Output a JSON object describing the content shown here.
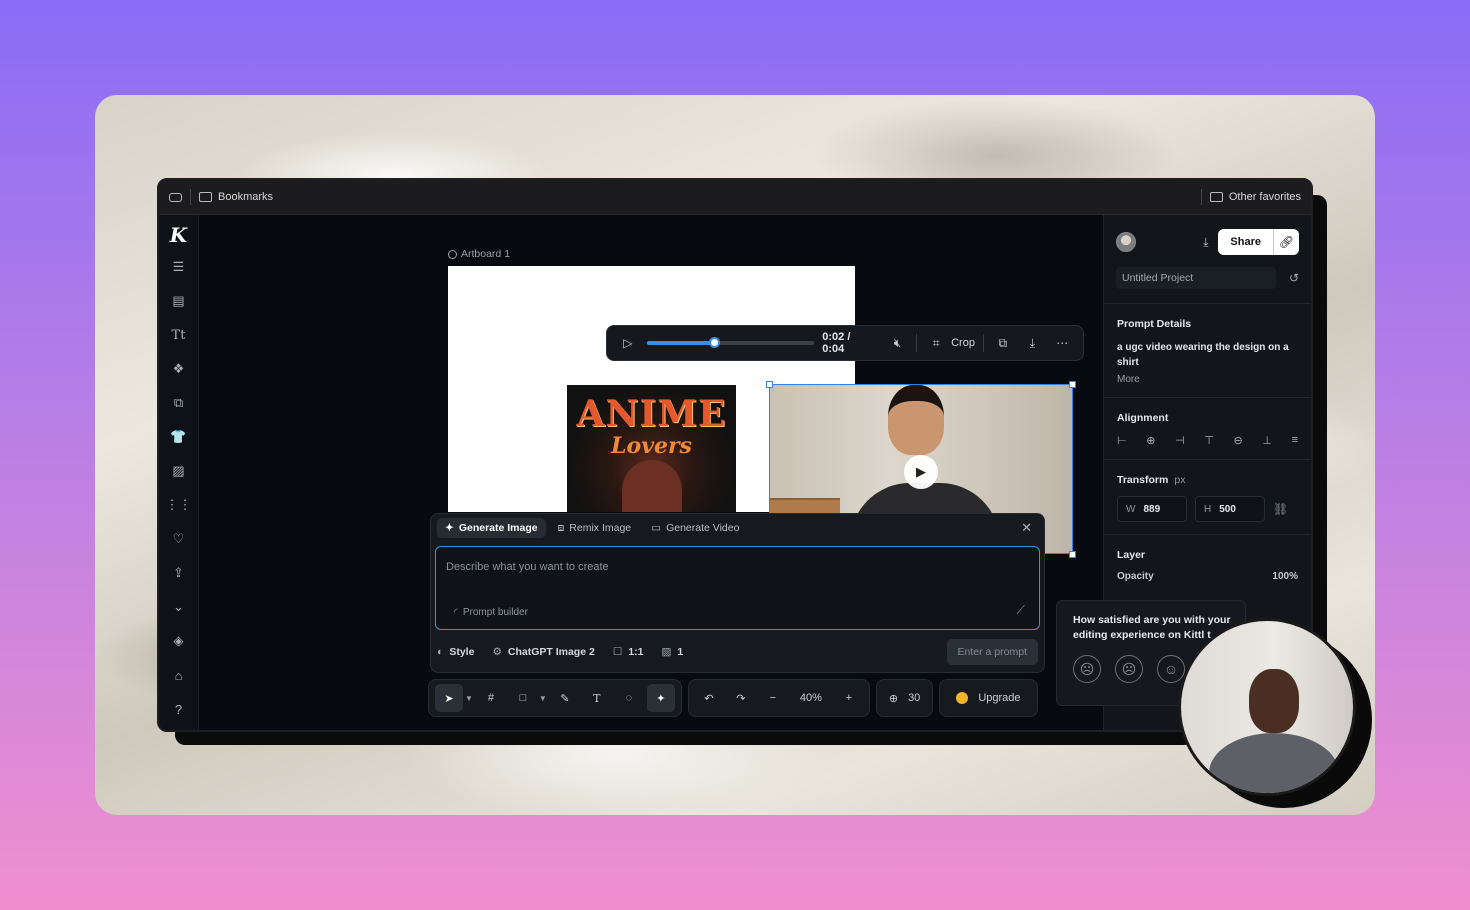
{
  "bookmarks_bar": {
    "bookmarks_label": "Bookmarks",
    "other_favorites_label": "Other favorites"
  },
  "app": {
    "logo": "K",
    "artboard_label": "Artboard 1",
    "left_rail_icons": [
      "menu-icon",
      "layout-icon",
      "text-icon",
      "elements-icon",
      "image-edit-icon",
      "shirt-icon",
      "image-icon",
      "grid-icon",
      "heart-icon",
      "upload-icon",
      "chevron-down-icon",
      "layers-icon",
      "graduation-cap-icon",
      "help-icon"
    ]
  },
  "media_toolbar": {
    "timecode": "0:02 / 0:04",
    "progress": 0.4,
    "crop_label": "Crop"
  },
  "shirt_design": {
    "title": "ANIME",
    "subtitle": "Lovers"
  },
  "generate_panel": {
    "tabs": [
      {
        "label": "Generate Image",
        "active": true
      },
      {
        "label": "Remix Image",
        "active": false
      },
      {
        "label": "Generate Video",
        "active": false
      }
    ],
    "placeholder": "Describe what you want to create",
    "prompt_builder_label": "Prompt builder",
    "style_label": "Style",
    "model_label": "ChatGPT Image 2",
    "ratio_label": "1:1",
    "count_label": "1",
    "enter_button_label": "Enter a prompt"
  },
  "bottom_toolbar": {
    "zoom_minus": "−",
    "zoom": "40%",
    "zoom_plus": "+",
    "credits": "30",
    "upgrade_label": "Upgrade"
  },
  "right_panel": {
    "share_label": "Share",
    "project_name": "Untitled Project",
    "prompt_details_title": "Prompt Details",
    "prompt_text": "a ugc video wearing the design on a shirt",
    "more_label": "More",
    "alignment_title": "Alignment",
    "transform_title": "Transform",
    "transform_unit": "px",
    "width_label": "W",
    "width_value": "889",
    "height_label": "H",
    "height_value": "500",
    "layer_title": "Layer",
    "opacity_label": "Opacity",
    "opacity_value": "100%"
  },
  "feedback": {
    "question": "How satisfied are you with your editing experience on Kittl t"
  },
  "colors": {
    "accent": "#3a8ee6",
    "coin": "#f0b429"
  }
}
